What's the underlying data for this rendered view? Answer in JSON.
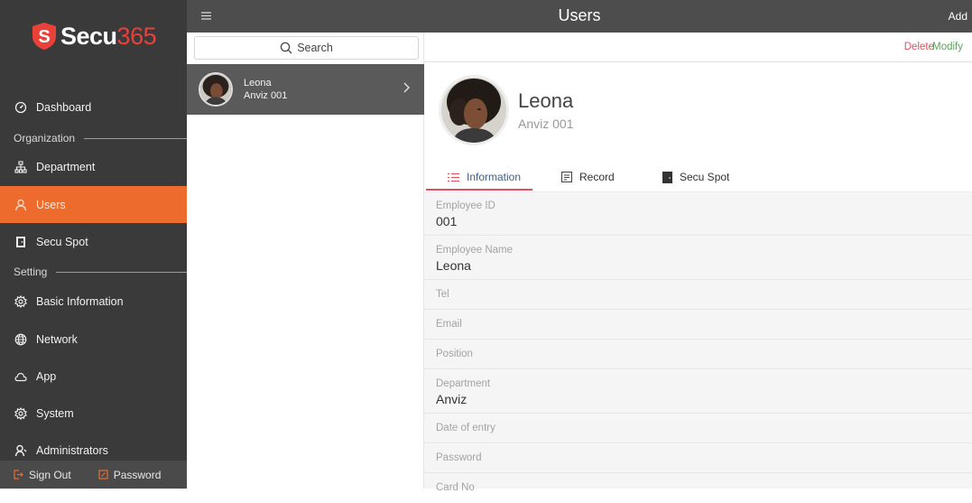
{
  "brand": {
    "name_part1": "Secu",
    "name_part2": "365"
  },
  "sidebar": {
    "items": [
      {
        "label": "Dashboard",
        "icon": "dashboard-icon"
      },
      {
        "label": "Department",
        "icon": "department-icon"
      },
      {
        "label": "Users",
        "icon": "user-icon",
        "active": true
      },
      {
        "label": "Secu Spot",
        "icon": "door-icon"
      },
      {
        "label": "Basic Information",
        "icon": "gear-icon"
      },
      {
        "label": "Network",
        "icon": "globe-icon"
      },
      {
        "label": "App",
        "icon": "cloud-icon"
      },
      {
        "label": "System",
        "icon": "gear-icon"
      },
      {
        "label": "Administrators",
        "icon": "admin-icon"
      }
    ],
    "sections": {
      "organization": "Organization",
      "setting": "Setting"
    },
    "footer": {
      "sign_out": "Sign Out",
      "password": "Password"
    },
    "accent_color": "#ec6b2d"
  },
  "topbar": {
    "title": "Users",
    "add_label": "Add"
  },
  "list": {
    "search_placeholder": "Search",
    "items": [
      {
        "name": "Leona",
        "subtitle": "Anviz 001"
      }
    ]
  },
  "detail": {
    "delete_label": "Delete",
    "modify_label": "Modify",
    "name": "Leona",
    "subtitle": "Anviz 001",
    "tabs": [
      {
        "label": "Information",
        "icon": "list-icon",
        "active": true
      },
      {
        "label": "Record",
        "icon": "record-icon"
      },
      {
        "label": "Secu Spot",
        "icon": "door-icon"
      }
    ],
    "fields": [
      {
        "label": "Employee ID",
        "value": "001"
      },
      {
        "label": "Employee Name",
        "value": "Leona"
      },
      {
        "label": "Tel",
        "value": ""
      },
      {
        "label": "Email",
        "value": ""
      },
      {
        "label": "Position",
        "value": ""
      },
      {
        "label": "Department",
        "value": "Anviz"
      },
      {
        "label": "Date of entry",
        "value": ""
      },
      {
        "label": "Password",
        "value": ""
      },
      {
        "label": "Card No",
        "value": ""
      }
    ]
  }
}
